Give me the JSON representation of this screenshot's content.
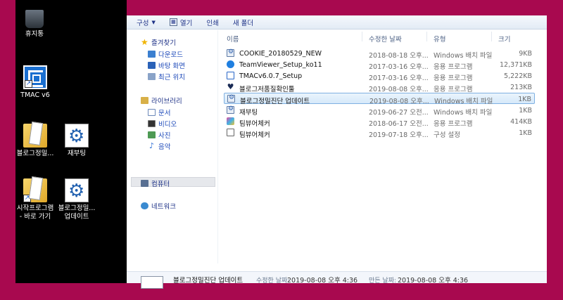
{
  "desktop": {
    "icons": [
      {
        "label": "휴지통",
        "icon": "recycle-bin-icon"
      },
      {
        "label": "TMAC v6",
        "icon": "tmac-icon"
      },
      {
        "label": "블로그정밀...",
        "icon": "folder-document-icon"
      },
      {
        "label": "재부팅",
        "icon": "gear-icon"
      },
      {
        "label": "시작프로그램\n- 바로 가기",
        "icon": "folder-document-icon"
      },
      {
        "label": "블로그정밀...\n업데이트",
        "icon": "gear-icon"
      }
    ]
  },
  "toolbar": {
    "organize": "구성",
    "open": "열기",
    "print": "인쇄",
    "new_folder": "새 폴더"
  },
  "nav": {
    "favorites": "즐겨찾기",
    "favorites_items": [
      "다운로드",
      "바탕 화면",
      "최근 위치"
    ],
    "libraries": "라이브러리",
    "libraries_items": [
      "문서",
      "비디오",
      "사진",
      "음악"
    ],
    "computer": "컴퓨터",
    "network": "네트워크"
  },
  "columns": {
    "name": "이름",
    "date": "수정한 날짜",
    "type": "유형",
    "size": "크기"
  },
  "files": [
    {
      "name": "COOKIE_20180529_NEW",
      "date": "2018-08-18 오후...",
      "type": "Windows 배치 파일",
      "size": "9KB",
      "icon": "batch-file-icon"
    },
    {
      "name": "TeamViewer_Setup_ko11",
      "date": "2017-03-16 오후...",
      "type": "응용 프로그램",
      "size": "12,371KB",
      "icon": "teamviewer-icon"
    },
    {
      "name": "TMACv6.0.7_Setup",
      "date": "2017-03-16 오후...",
      "type": "응용 프로그램",
      "size": "5,222KB",
      "icon": "tmac-icon"
    },
    {
      "name": "블로그저품질확인툴",
      "date": "2019-08-08 오후...",
      "type": "응용 프로그램",
      "size": "213KB",
      "icon": "heart-icon"
    },
    {
      "name": "블로그정밀진단 업데이트",
      "date": "2019-08-08 오후...",
      "type": "Windows 배치 파일",
      "size": "1KB",
      "icon": "batch-file-icon"
    },
    {
      "name": "재부팅",
      "date": "2019-06-27 오전...",
      "type": "Windows 배치 파일",
      "size": "1KB",
      "icon": "batch-file-icon"
    },
    {
      "name": "팀뷰어체커",
      "date": "2018-06-17 오전...",
      "type": "응용 프로그램",
      "size": "414KB",
      "icon": "cube-icon"
    },
    {
      "name": "팀뷰어체커",
      "date": "2019-07-18 오후...",
      "type": "구성 설정",
      "size": "1KB",
      "icon": "config-file-icon"
    }
  ],
  "details": {
    "name": "블로그정밀진단 업데이트",
    "modified_label": "수정한 날짜:",
    "modified_value": "2019-08-08 오후 4:36",
    "created_label": "만든 날짜:",
    "created_value": "2019-08-08 오후 4:36"
  }
}
